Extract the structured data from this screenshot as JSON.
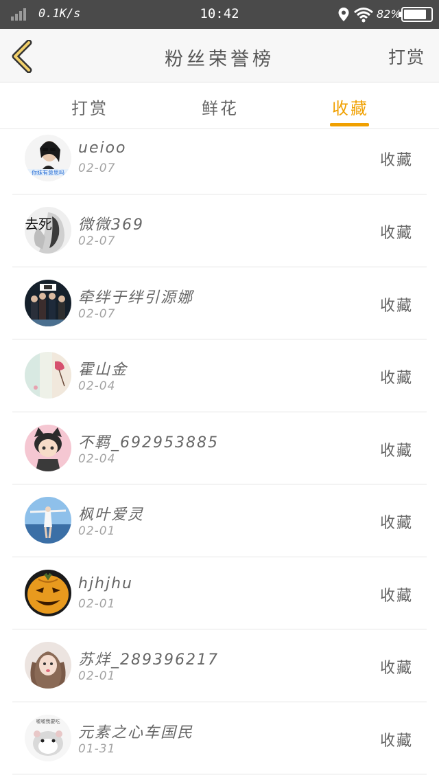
{
  "status_bar": {
    "speed": "0.1K/s",
    "time": "10:42",
    "battery": "82%"
  },
  "header": {
    "title": "粉丝荣誉榜",
    "action": "打赏"
  },
  "tabs": [
    {
      "label": "打赏",
      "active": false
    },
    {
      "label": "鲜花",
      "active": false
    },
    {
      "label": "收藏",
      "active": true
    }
  ],
  "accent_color": "#f0a000",
  "fans": [
    {
      "name": "ueioo",
      "date": "02-07",
      "label": "收藏",
      "avatar_text": "你妹有意思吗"
    },
    {
      "name": "微微369",
      "date": "02-07",
      "label": "收藏",
      "avatar_text": "去死"
    },
    {
      "name": "牵绊于绊引源娜",
      "date": "02-07",
      "label": "收藏"
    },
    {
      "name": "霍山金",
      "date": "02-04",
      "label": "收藏"
    },
    {
      "name": "不羁_692953885",
      "date": "02-04",
      "label": "收藏"
    },
    {
      "name": "枫叶爱灵",
      "date": "02-01",
      "label": "收藏"
    },
    {
      "name": "hjhjhu",
      "date": "02-01",
      "label": "收藏"
    },
    {
      "name": "苏烊_289396217",
      "date": "02-01",
      "label": "收藏"
    },
    {
      "name": "元素之心车国民",
      "date": "01-31",
      "label": "收藏",
      "avatar_text": "嘘嘘我要吃"
    }
  ]
}
